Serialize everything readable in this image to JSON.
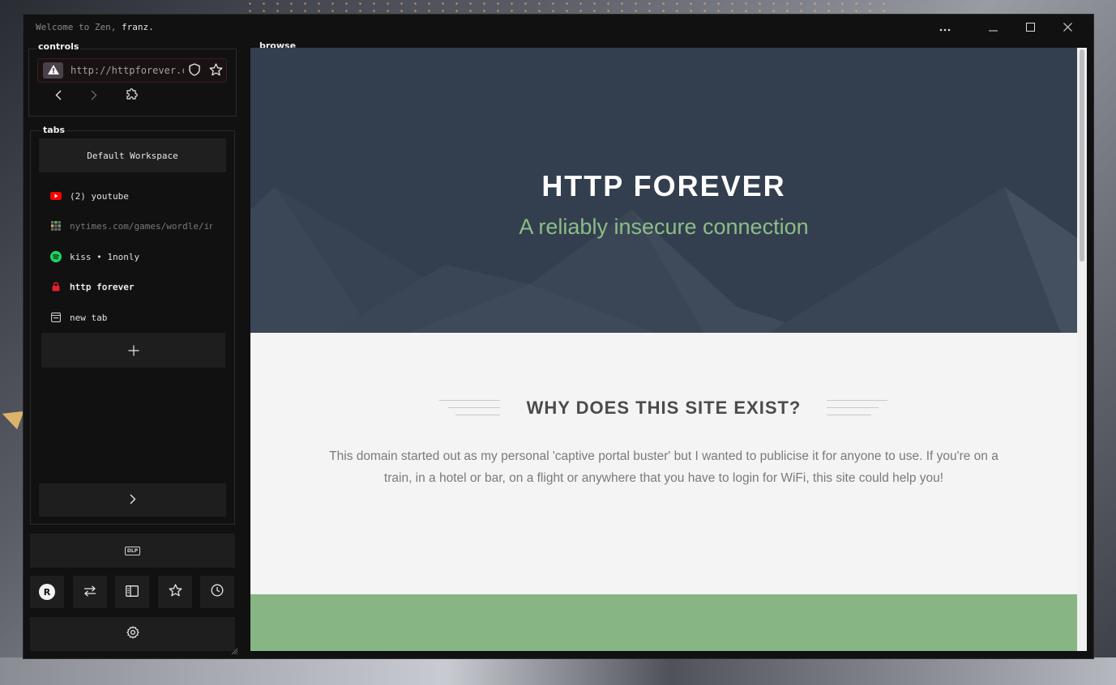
{
  "window": {
    "welcome_prefix": "Welcome to Zen,",
    "username": "franz.",
    "controls": {
      "menu_icon": "ellipsis-icon",
      "minimize_icon": "minimize-icon",
      "maximize_icon": "maximize-icon",
      "close_icon": "close-icon"
    }
  },
  "sidebar": {
    "controls_label": "controls",
    "url": "http://httpforever.com/",
    "tabs_label": "tabs",
    "workspace": "Default Workspace",
    "tabs": [
      {
        "label": "(2) youtube",
        "icon": "youtube-icon",
        "color": "#ff0000"
      },
      {
        "label": "nytimes.com/games/wordle/index.html",
        "icon": "wordle-grid-icon",
        "color": "#6aaa64"
      },
      {
        "label": "kiss • 1nonly",
        "icon": "spotify-icon",
        "color": "#1ed760"
      },
      {
        "label": "http forever",
        "icon": "lock-icon",
        "color": "#e5202e"
      },
      {
        "label": "new tab",
        "icon": "new-tab-icon",
        "color": "#cfcfcf"
      }
    ],
    "dlp_label": "DLP",
    "avatar_letter": "R"
  },
  "browse_label": "browse",
  "page": {
    "hero_title": "HTTP FOREVER",
    "hero_subtitle": "A reliably insecure connection",
    "why_title": "WHY DOES THIS SITE EXIST?",
    "why_text": "This domain started out as my personal 'captive portal buster' but I wanted to publicise it for anyone to use. If you're on a train, in a hotel or bar, on a flight or anywhere that you have to login for WiFi, this site could help you!",
    "colors": {
      "hero_bg": "#333f4e",
      "accent_green": "#87b583",
      "subtitle_green": "#8cbd88"
    }
  }
}
